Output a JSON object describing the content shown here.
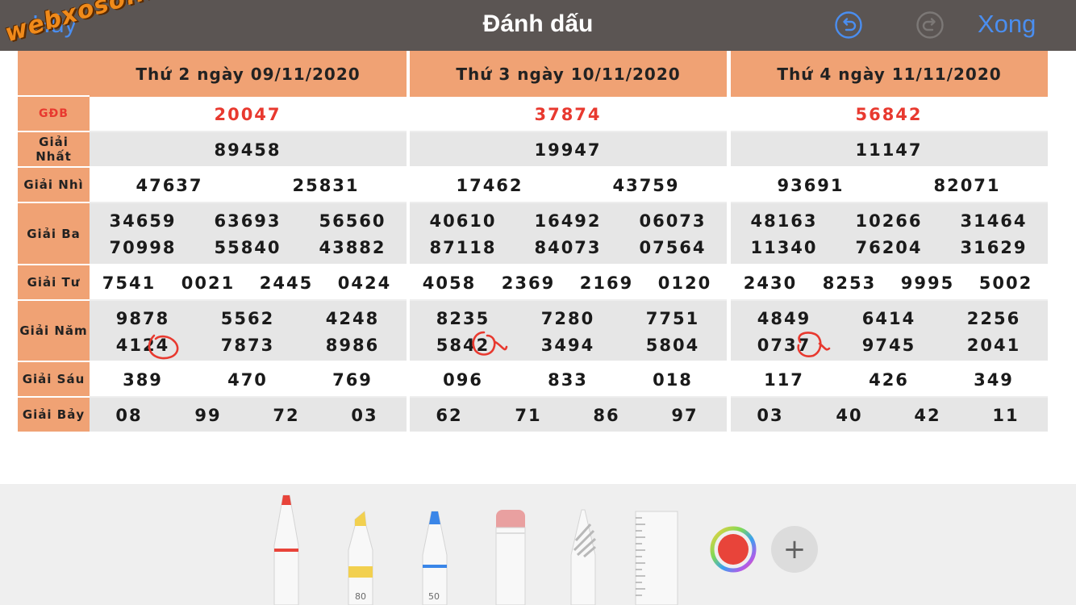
{
  "topbar": {
    "cancel_label": "Hủy",
    "title": "Đánh dấu",
    "done_label": "Xong",
    "undo_icon": "undo-icon",
    "redo_icon": "redo-icon"
  },
  "watermark": "webxoso.net",
  "labels": {
    "gdb": "GĐB",
    "nhat": "Giải Nhất",
    "nhi": "Giải Nhì",
    "ba": "Giải Ba",
    "tu": "Giải Tư",
    "nam": "Giải Năm",
    "sau": "Giải Sáu",
    "bay": "Giải Bảy"
  },
  "days": [
    {
      "header": "Thứ 2 ngày 09/11/2020",
      "gdb": "20047",
      "nhat": "89458",
      "nhi": [
        "47637",
        "25831"
      ],
      "ba": [
        "34659",
        "63693",
        "56560",
        "70998",
        "55840",
        "43882"
      ],
      "tu": [
        "7541",
        "0021",
        "2445",
        "0424"
      ],
      "nam": [
        "9878",
        "5562",
        "4248",
        "4124",
        "7873",
        "8986"
      ],
      "sau": [
        "389",
        "470",
        "769"
      ],
      "bay": [
        "08",
        "99",
        "72",
        "03"
      ]
    },
    {
      "header": "Thứ 3 ngày 10/11/2020",
      "gdb": "37874",
      "nhat": "19947",
      "nhi": [
        "17462",
        "43759"
      ],
      "ba": [
        "40610",
        "16492",
        "06073",
        "87118",
        "84073",
        "07564"
      ],
      "tu": [
        "4058",
        "2369",
        "2169",
        "0120"
      ],
      "nam": [
        "8235",
        "7280",
        "7751",
        "5842",
        "3494",
        "5804"
      ],
      "sau": [
        "096",
        "833",
        "018"
      ],
      "bay": [
        "62",
        "71",
        "86",
        "97"
      ]
    },
    {
      "header": "Thứ 4 ngày 11/11/2020",
      "gdb": "56842",
      "nhat": "11147",
      "nhi": [
        "93691",
        "82071"
      ],
      "ba": [
        "48163",
        "10266",
        "31464",
        "11340",
        "76204",
        "31629"
      ],
      "tu": [
        "2430",
        "8253",
        "9995",
        "5002"
      ],
      "nam": [
        "4849",
        "6414",
        "2256",
        "0737",
        "9745",
        "2041"
      ],
      "sau": [
        "117",
        "426",
        "349"
      ],
      "bay": [
        "03",
        "40",
        "42",
        "11"
      ]
    }
  ],
  "toolbar": {
    "marker_width": "80",
    "pen_width": "50",
    "selected_color": "#e8443a",
    "tools": [
      "pen-tool",
      "marker-tool",
      "pencil-tool",
      "eraser-tool",
      "lasso-tool",
      "ruler-tool"
    ],
    "add_label": "+"
  }
}
